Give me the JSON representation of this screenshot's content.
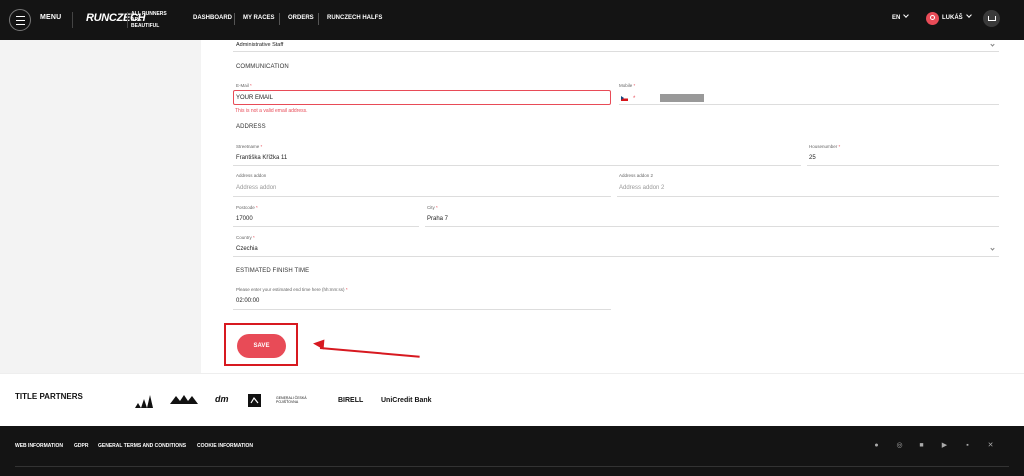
{
  "header": {
    "menu_label": "MENU",
    "logo_text": "RUNCZECH",
    "tagline": "ALL RUNNERS ARE BEAUTIFUL",
    "nav": [
      "DASHBOARD",
      "MY RACES",
      "ORDERS",
      "RUNCZECH HALFS"
    ],
    "language": "EN",
    "user_name": "LUKÁŠ"
  },
  "form": {
    "staff_value": "Administrative Staff",
    "communication_title": "COMMUNICATION",
    "email_label": "E-Mail",
    "email_value": "YOUR EMAIL",
    "email_error": "This is not a valid email address.",
    "mobile_label": "Mobile",
    "address_title": "ADDRESS",
    "street_label": "Streetname",
    "street_value": "Františka Křížka 11",
    "housenumber_label": "Housenumber",
    "housenumber_value": "25",
    "addon_label": "Address addon",
    "addon_placeholder": "Address addon",
    "addon2_label": "Address addon 2",
    "addon2_placeholder": "Address addon 2",
    "postcode_label": "Postcode",
    "postcode_value": "17000",
    "city_label": "City",
    "city_value": "Praha 7",
    "country_label": "Country",
    "country_value": "Czechia",
    "finish_title": "ESTIMATED FINISH TIME",
    "finish_label": "Please enter your estimated end time here (hh:mm:ss)",
    "finish_value": "02:00:00",
    "required_mark": "*",
    "save_label": "SAVE"
  },
  "partners": {
    "title": "TITLE PARTNERS",
    "logos": [
      "adidas-logo",
      "mattoni-logo",
      "dm-logo",
      "logo-4",
      "generali-logo",
      "birell-logo",
      "unicredit-logo"
    ],
    "text_logos": {
      "generali": "GENERALI ČESKÁ POJIŠŤOVNA",
      "birell": "BIRELL",
      "unicredit": "UniCredit Bank",
      "dm": "dm"
    }
  },
  "footer": {
    "links": [
      "WEB INFORMATION",
      "GDPR",
      "GENERAL TERMS AND CONDITIONS",
      "COOKIE INFORMATION"
    ],
    "social_icons": [
      "facebook-icon",
      "instagram-icon",
      "linkedin-icon",
      "youtube-icon",
      "flickr-icon",
      "x-icon"
    ]
  },
  "colors": {
    "accent": "#e84b57",
    "highlight": "#d71920",
    "dark": "#141414"
  }
}
